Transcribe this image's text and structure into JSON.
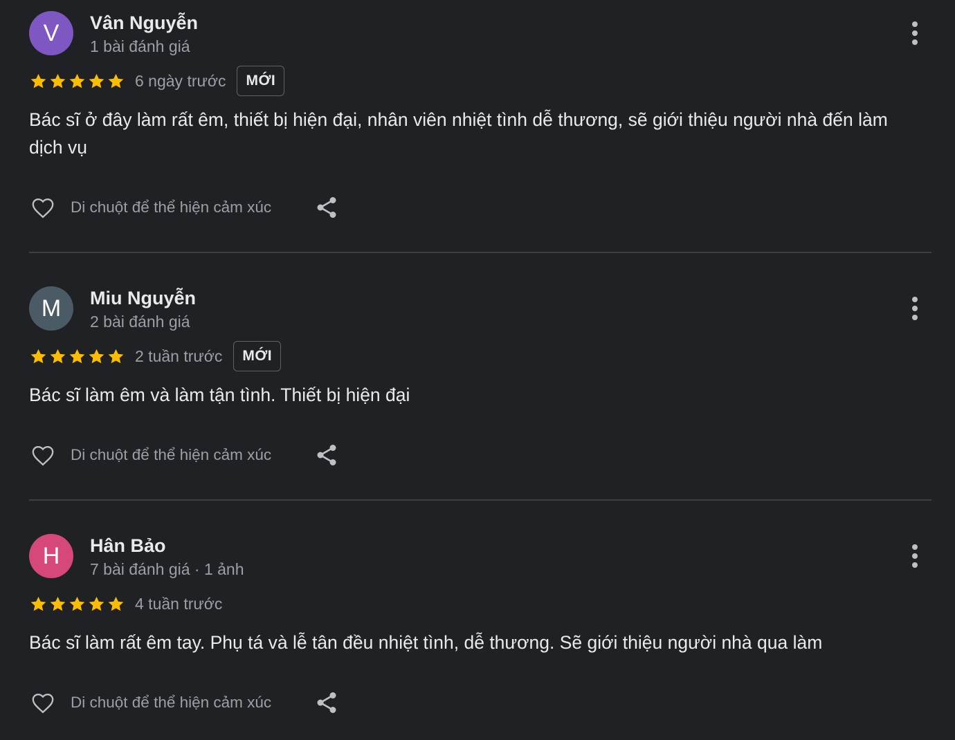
{
  "reviews": [
    {
      "author": "Vân Nguyễn",
      "avatar_letter": "V",
      "avatar_color": "#7e57c2",
      "meta": "1 bài đánh giá",
      "stars": 5,
      "date": "6 ngày trước",
      "badge": "MỚI",
      "text": "Bác sĩ ở đây làm rất êm, thiết bị hiện đại, nhân viên nhiệt tình dễ thương, sẽ giới thiệu người nhà đến làm dịch vụ",
      "react_label": "Di chuột để thể hiện cảm xúc"
    },
    {
      "author": "Miu Nguyễn",
      "avatar_letter": "M",
      "avatar_color": "#4b5b66",
      "meta": "2 bài đánh giá",
      "stars": 5,
      "date": "2 tuần trước",
      "badge": "MỚI",
      "text": "Bác sĩ làm êm và làm tận tình. Thiết bị hiện đại",
      "react_label": "Di chuột để thể hiện cảm xúc"
    },
    {
      "author": "Hân Bảo",
      "avatar_letter": "H",
      "avatar_color": "#d6477a",
      "meta": "7 bài đánh giá · 1 ảnh",
      "stars": 5,
      "date": "4 tuần trước",
      "badge": "",
      "text": "Bác sĩ làm rất êm tay. Phụ tá và lễ tân đều nhiệt tình, dễ thương. Sẽ giới thiệu người nhà qua làm",
      "react_label": "Di chuột để thể hiện cảm xúc"
    }
  ],
  "colors": {
    "background": "#202124",
    "star": "#fbbc04",
    "text_primary": "#e8eaed",
    "text_secondary": "#9aa0a6",
    "divider": "#3c4043"
  },
  "icons": {
    "more": "more-vert-icon",
    "react": "heart-outline-icon",
    "share": "share-icon",
    "star": "star-icon"
  }
}
